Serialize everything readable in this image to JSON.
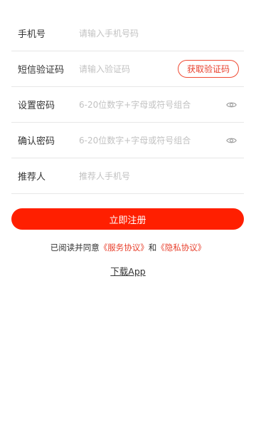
{
  "form": {
    "phone": {
      "label": "手机号",
      "placeholder": "请输入手机号码"
    },
    "sms_code": {
      "label": "短信验证码",
      "placeholder": "请输入验证码",
      "button_label": "获取验证码"
    },
    "password": {
      "label": "设置密码",
      "placeholder": "6-20位数字+字母或符号组合",
      "icon": "eye-icon"
    },
    "confirm_password": {
      "label": "确认密码",
      "placeholder": "6-20位数字+字母或符号组合",
      "icon": "eye-icon"
    },
    "referrer": {
      "label": "推荐人",
      "placeholder": "推荐人手机号"
    }
  },
  "submit_label": "立即注册",
  "agreement": {
    "prefix": "已阅读并同意",
    "service_link": "《服务协议》",
    "conjunction": "和",
    "privacy_link": "《隐私协议》"
  },
  "download_label": "下载App",
  "colors": {
    "primary": "#ff1f00",
    "link": "#e8402d",
    "divider": "#e7e7e7",
    "placeholder": "#c2c2c2"
  }
}
